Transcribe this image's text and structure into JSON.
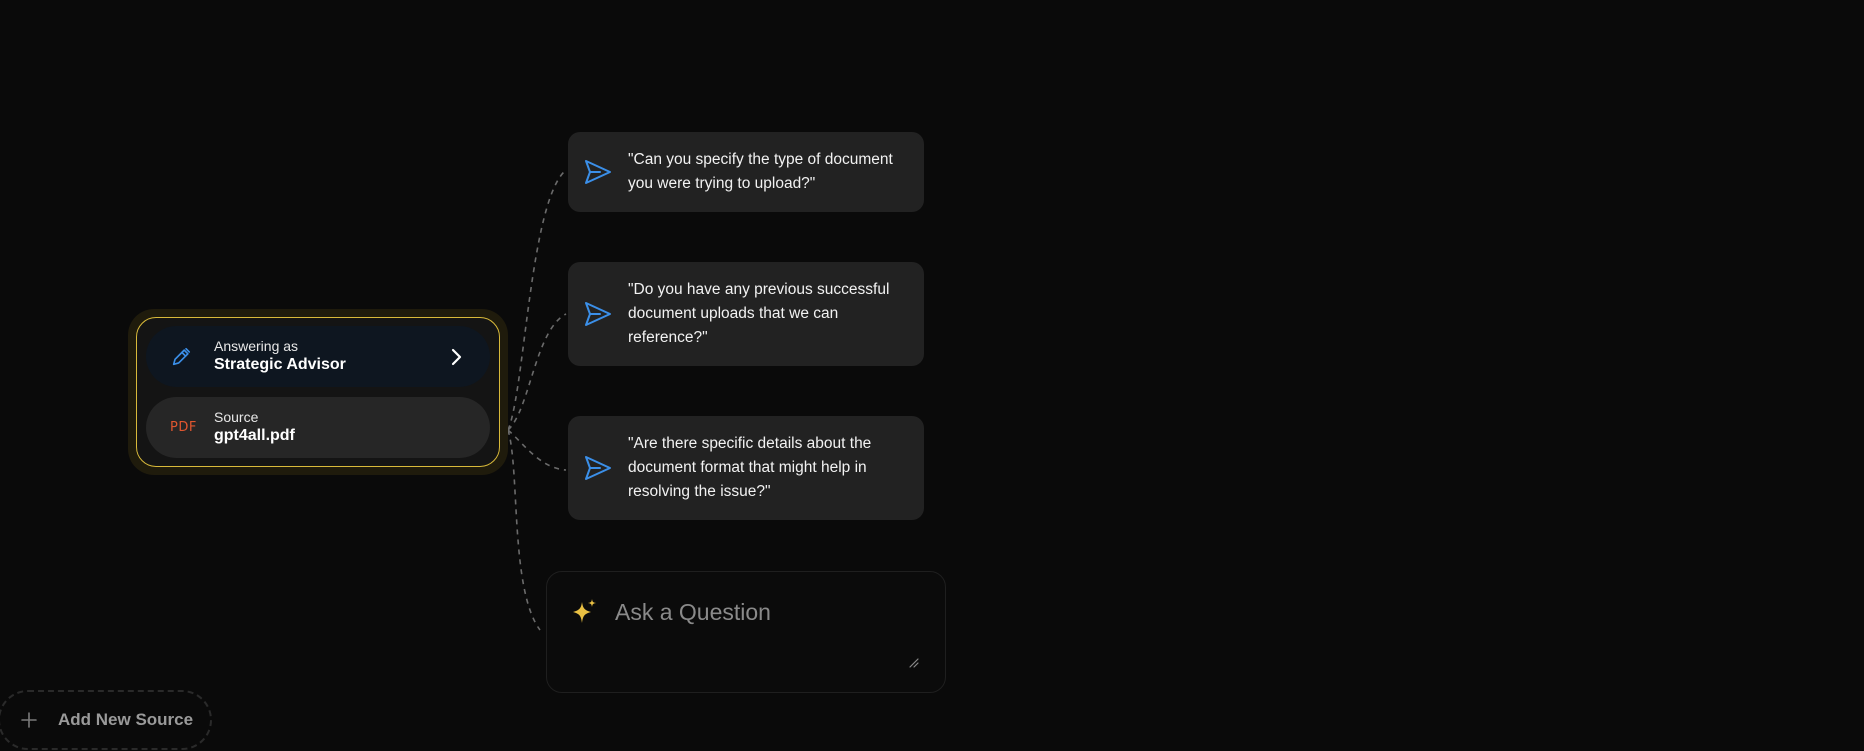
{
  "context": {
    "persona_caption": "Answering as",
    "persona_name": "Strategic Advisor",
    "source_badge": "PDF",
    "source_caption": "Source",
    "source_name": "gpt4all.pdf"
  },
  "suggestions": [
    {
      "text": "\"Can you specify the type of document you were trying to upload?\"",
      "icon": "send-icon"
    },
    {
      "text": "\"Do you have any previous successful document uploads that we can reference?\"",
      "icon": "send-icon"
    },
    {
      "text": "\"Are there specific details about the document format that might help in resolving the issue?\"",
      "icon": "send-icon"
    }
  ],
  "ask": {
    "placeholder": "Ask a Question",
    "icon": "sparkle-icon"
  },
  "add_source": {
    "label": "Add New Source",
    "icon": "plus-icon"
  },
  "colors": {
    "background": "#0a0a0a",
    "accent_gold": "#d8b93a",
    "accent_blue": "#3b8fe8",
    "pdf_orange": "#e0562f",
    "card_bg": "#222222"
  }
}
